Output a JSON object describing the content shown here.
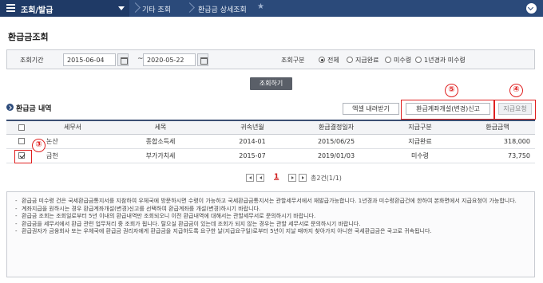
{
  "nav": {
    "main_menu": "조회/발급",
    "crumb1": "기타 조회",
    "crumb2": "환급금 상세조회"
  },
  "page_title": "환급금조회",
  "search": {
    "period_label": "조회기간",
    "date_from": "2015-06-04",
    "date_to": "2020-05-22",
    "range_sep": "~",
    "type_label": "조회구분",
    "options": [
      "전체",
      "지급완료",
      "미수령",
      "1년경과 미수령"
    ],
    "selected": "전체",
    "submit_label": "조회하기"
  },
  "section": {
    "title": "환급금 내역",
    "excel_label": "엑셀 내려받기",
    "account_label": "환급계좌개설(변경)신고",
    "pay_request_label": "지급요청"
  },
  "annotations": {
    "marker3": "③",
    "marker4": "④",
    "marker5": "⑤",
    "colors": {
      "annotation": "#e02020",
      "nav": "#2b4a7a"
    }
  },
  "table": {
    "headers": [
      "세무서",
      "세목",
      "귀속년월",
      "환급결정일자",
      "지급구분",
      "환급금액"
    ],
    "rows": [
      {
        "checked": false,
        "office": "논산",
        "tax": "종합소득세",
        "period": "2014-01",
        "decision_date": "2015/06/25",
        "status": "지급완료",
        "amount": "318,000"
      },
      {
        "checked": true,
        "office": "금천",
        "tax": "부가가치세",
        "period": "2015-07",
        "decision_date": "2019/01/03",
        "status": "미수령",
        "amount": "73,750"
      }
    ]
  },
  "pagination": {
    "current": "1",
    "total": "총2건(1/1)"
  },
  "notes": [
    "환급금 미수령 건은 국세환급금통지서를 지참하여 우체국에 방문하시면 수령이 가능하고 국세환급금통지서는 관할세무서에서 재발급가능합니다. 1년경과 미수령환급건에 한하여 본화면에서 지급요청이 가능합니다.",
    "계좌지급을 원하시는 경우 환급계좌개설(변경)신고를 선택하여 환급계좌를 개설(변경)하시기 바랍니다.",
    "환급금 조회는 조회일로부터 5년 이내의 환급내역만 조회되오니 이전 환급내역에 대해서는 관할세무서로 문의하시기 바랍니다.",
    "환급금을 세무서에서 환급 관련 업무처리 중 조회가 됩니다. 탈으실 환급금이 있는데 조회가 되지 않는 경우는 관할 세무서로 문의하시기 바랍니다.",
    "환급권자가 금융회사 또는 우체국에 환급금 권리자에게 환급금을 지급하도록 요구한 날(지급요구일)로부터 5년이 지날 때까지 찾아가지 아니한 국세환급금은 국고로 귀속됩니다."
  ]
}
